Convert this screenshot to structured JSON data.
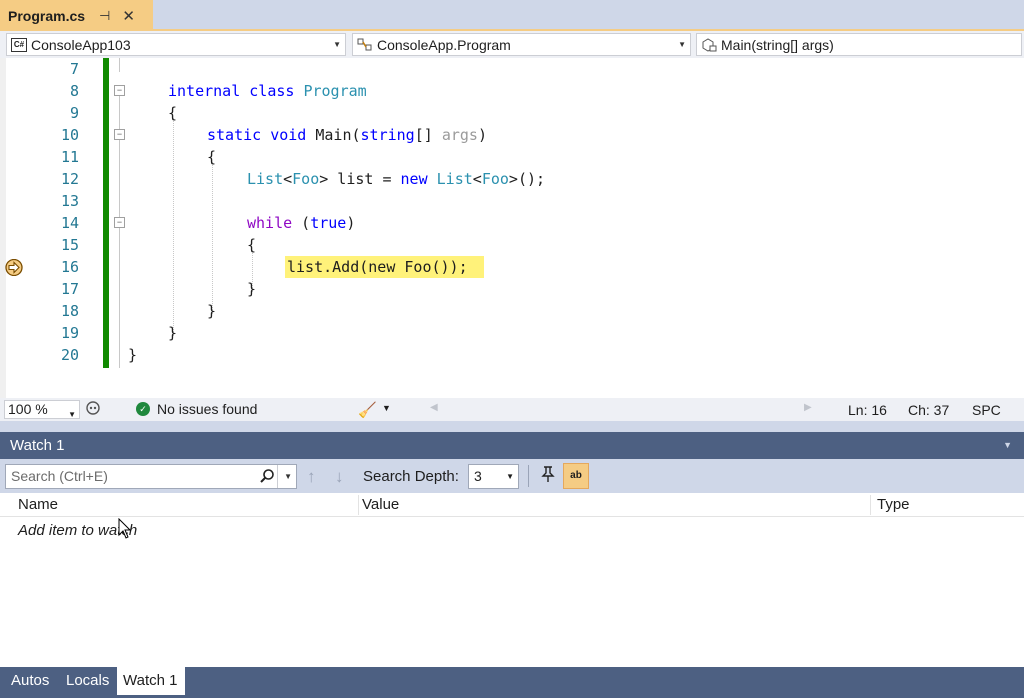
{
  "tab": {
    "title": "Program.cs",
    "pin_glyph": "⊣",
    "close_glyph": "✕"
  },
  "navbar": {
    "project": "ConsoleApp103",
    "class": "ConsoleApp.Program",
    "member": "Main(string[] args)",
    "cs_icon_text": "C#"
  },
  "editor": {
    "lines": [
      {
        "num": "7"
      },
      {
        "num": "8",
        "code": "internal class Program"
      },
      {
        "num": "9",
        "code": "{"
      },
      {
        "num": "10",
        "code": "static void Main(string[] args)"
      },
      {
        "num": "11",
        "code": "{"
      },
      {
        "num": "12",
        "code": "List<Foo> list = new List<Foo>();"
      },
      {
        "num": "13"
      },
      {
        "num": "14",
        "code": "while (true)"
      },
      {
        "num": "15",
        "code": "{"
      },
      {
        "num": "16",
        "code": "list.Add(new Foo());"
      },
      {
        "num": "17",
        "code": "}"
      },
      {
        "num": "18",
        "code": "}"
      },
      {
        "num": "19",
        "code": "}"
      },
      {
        "num": "20",
        "code": "}"
      }
    ],
    "tokens": {
      "internal": "internal",
      "class": "class",
      "Program": "Program",
      "static": "static",
      "void": "void",
      "Main": "Main",
      "open_paren": "(",
      "string": "string",
      "brackets": "[]",
      "args": "args",
      "close_paren": ")",
      "List": "List",
      "lt": "<",
      "Foo": "Foo",
      "gt": ">",
      "list_var": " list = ",
      "new": "new",
      "call_end": "();",
      "while": "while",
      "true": "true",
      "while_open": " (",
      "while_close": ")",
      "add_stmt": "list.Add(new Foo());",
      "brace_open": "{",
      "brace_close": "}"
    },
    "colors": {
      "keyword": "#0000ff",
      "type": "#2b91af",
      "line_number": "#237893",
      "current_statement": "#fff27a",
      "change_bar": "#108a00"
    }
  },
  "status": {
    "zoom": "100 %",
    "issues": "No issues found",
    "ln": "Ln: 16",
    "ch": "Ch: 37",
    "spc": "SPC"
  },
  "watch": {
    "title": "Watch 1",
    "search_placeholder": "Search (Ctrl+E)",
    "search_depth_label": "Search Depth:",
    "search_depth_value": "3",
    "hex_label": "ab",
    "columns": [
      "Name",
      "Value",
      "Type"
    ],
    "add_item": "Add item to watch"
  },
  "bottom_tabs": [
    {
      "label": "Autos",
      "active": false
    },
    {
      "label": "Locals",
      "active": false
    },
    {
      "label": "Watch 1",
      "active": true
    }
  ]
}
